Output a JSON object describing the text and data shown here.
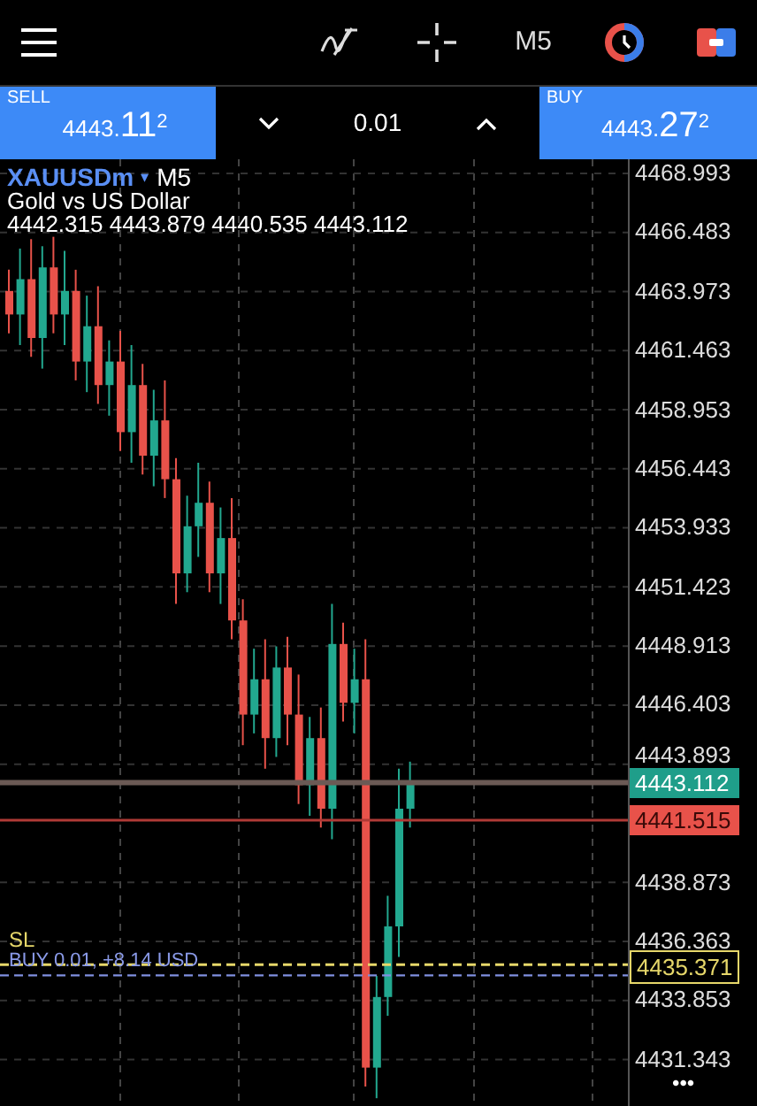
{
  "toolbar": {
    "timeframe": "M5"
  },
  "trade_bar": {
    "sell": {
      "label": "SELL",
      "price_main": "4443.",
      "price_big": "11",
      "price_sup": "2"
    },
    "volume": "0.01",
    "buy": {
      "label": "BUY",
      "price_main": "4443.",
      "price_big": "27",
      "price_sup": "2"
    }
  },
  "chart": {
    "symbol": "XAUUSDm",
    "symbol_caret": "▾",
    "timeframe": "M5",
    "description": "Gold vs US Dollar",
    "ohlc": "4442.315 4443.879 4440.535 4443.112",
    "price_axis": [
      "4468.993",
      "4466.483",
      "4463.973",
      "4461.463",
      "4458.953",
      "4456.443",
      "4453.933",
      "4451.423",
      "4448.913",
      "4446.403",
      "4443.893",
      "4438.873",
      "4436.363",
      "4433.853",
      "4431.343"
    ],
    "price_tags": [
      {
        "kind": "bid",
        "value": "4443.112"
      },
      {
        "kind": "ask",
        "value": "4441.515"
      },
      {
        "kind": "sl",
        "value": "4435.371"
      }
    ],
    "sl_label": "SL",
    "position_label": "BUY 0.01, +8.14 USD",
    "more": "•••"
  }
}
